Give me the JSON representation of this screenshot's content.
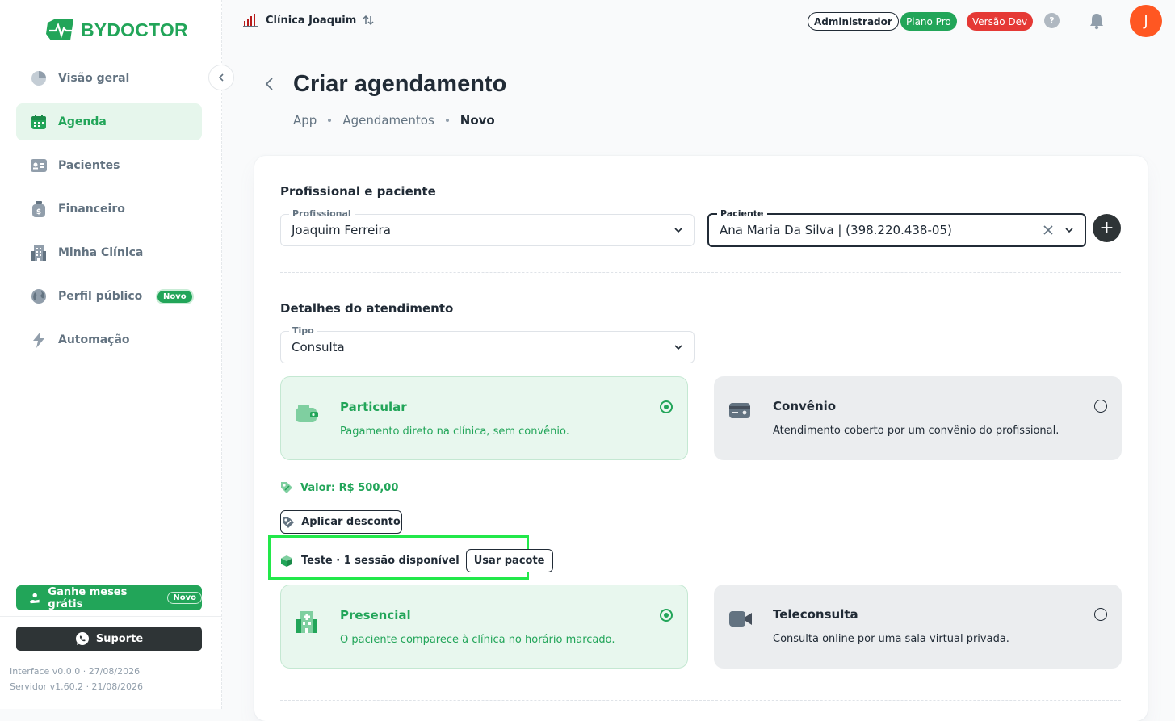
{
  "brand": {
    "name": "BYDOCTOR",
    "color": "#22a559"
  },
  "sidebar": {
    "items": [
      {
        "label": "Visão geral",
        "icon": "pie-chart-icon"
      },
      {
        "label": "Agenda",
        "icon": "calendar-icon",
        "active": true
      },
      {
        "label": "Pacientes",
        "icon": "id-card-icon"
      },
      {
        "label": "Financeiro",
        "icon": "money-bag-icon"
      },
      {
        "label": "Minha Clínica",
        "icon": "building-icon"
      },
      {
        "label": "Perfil público",
        "icon": "globe-icon",
        "badge": "Novo"
      },
      {
        "label": "Automação",
        "icon": "lightning-icon"
      }
    ],
    "promo": {
      "label": "Ganhe meses grátis",
      "badge": "Novo"
    },
    "support": {
      "label": "Suporte"
    },
    "version_interface": "Interface v0.0.0 · 27/08/2026",
    "version_server": "Servidor v1.60.2 · 21/08/2026"
  },
  "topbar": {
    "clinic": "Clínica Joaquim",
    "role": "Administrador",
    "plan": "Plano Pro",
    "env": "Versão Dev",
    "help": "?",
    "avatar_initial": "J"
  },
  "page": {
    "title": "Criar agendamento",
    "breadcrumb": [
      "App",
      "Agendamentos",
      "Novo"
    ]
  },
  "form": {
    "section1_title": "Profissional e paciente",
    "profissional": {
      "label": "Profissional",
      "value": "Joaquim Ferreira"
    },
    "paciente": {
      "label": "Paciente",
      "value": "Ana Maria Da Silva | (398.220.438-05)"
    },
    "add_label": "+",
    "section2_title": "Detalhes do atendimento",
    "tipo": {
      "label": "Tipo",
      "value": "Consulta"
    },
    "payment_options": [
      {
        "title": "Particular",
        "desc": "Pagamento direto na clínica, sem convênio.",
        "selected": true
      },
      {
        "title": "Convênio",
        "desc": "Atendimento coberto por um convênio do profissional.",
        "selected": false
      }
    ],
    "valor": "Valor: R$ 500,00",
    "discount_label": "Aplicar desconto",
    "package": {
      "text": "Teste · 1 sessão disponível",
      "button": "Usar pacote"
    },
    "mode_options": [
      {
        "title": "Presencial",
        "desc": "O paciente comparece à clínica no horário marcado.",
        "selected": true
      },
      {
        "title": "Teleconsulta",
        "desc": "Consulta online por uma sala virtual privada.",
        "selected": false
      }
    ]
  },
  "colors": {
    "accent": "#22a559",
    "danger": "#e53935",
    "avatar": "#ff5722",
    "highlight": "#22e84a"
  }
}
